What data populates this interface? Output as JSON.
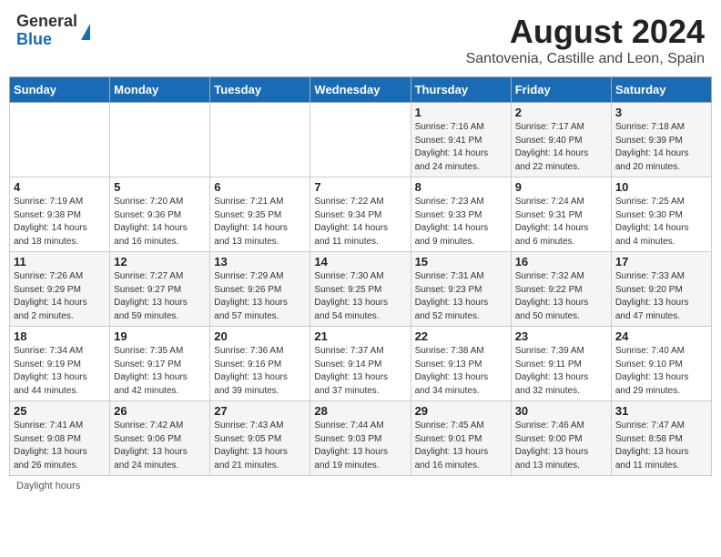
{
  "header": {
    "logo_general": "General",
    "logo_blue": "Blue",
    "main_title": "August 2024",
    "sub_title": "Santovenia, Castille and Leon, Spain"
  },
  "days_of_week": [
    "Sunday",
    "Monday",
    "Tuesday",
    "Wednesday",
    "Thursday",
    "Friday",
    "Saturday"
  ],
  "weeks": [
    [
      {
        "day": "",
        "info": ""
      },
      {
        "day": "",
        "info": ""
      },
      {
        "day": "",
        "info": ""
      },
      {
        "day": "",
        "info": ""
      },
      {
        "day": "1",
        "info": "Sunrise: 7:16 AM\nSunset: 9:41 PM\nDaylight: 14 hours\nand 24 minutes."
      },
      {
        "day": "2",
        "info": "Sunrise: 7:17 AM\nSunset: 9:40 PM\nDaylight: 14 hours\nand 22 minutes."
      },
      {
        "day": "3",
        "info": "Sunrise: 7:18 AM\nSunset: 9:39 PM\nDaylight: 14 hours\nand 20 minutes."
      }
    ],
    [
      {
        "day": "4",
        "info": "Sunrise: 7:19 AM\nSunset: 9:38 PM\nDaylight: 14 hours\nand 18 minutes."
      },
      {
        "day": "5",
        "info": "Sunrise: 7:20 AM\nSunset: 9:36 PM\nDaylight: 14 hours\nand 16 minutes."
      },
      {
        "day": "6",
        "info": "Sunrise: 7:21 AM\nSunset: 9:35 PM\nDaylight: 14 hours\nand 13 minutes."
      },
      {
        "day": "7",
        "info": "Sunrise: 7:22 AM\nSunset: 9:34 PM\nDaylight: 14 hours\nand 11 minutes."
      },
      {
        "day": "8",
        "info": "Sunrise: 7:23 AM\nSunset: 9:33 PM\nDaylight: 14 hours\nand 9 minutes."
      },
      {
        "day": "9",
        "info": "Sunrise: 7:24 AM\nSunset: 9:31 PM\nDaylight: 14 hours\nand 6 minutes."
      },
      {
        "day": "10",
        "info": "Sunrise: 7:25 AM\nSunset: 9:30 PM\nDaylight: 14 hours\nand 4 minutes."
      }
    ],
    [
      {
        "day": "11",
        "info": "Sunrise: 7:26 AM\nSunset: 9:29 PM\nDaylight: 14 hours\nand 2 minutes."
      },
      {
        "day": "12",
        "info": "Sunrise: 7:27 AM\nSunset: 9:27 PM\nDaylight: 13 hours\nand 59 minutes."
      },
      {
        "day": "13",
        "info": "Sunrise: 7:29 AM\nSunset: 9:26 PM\nDaylight: 13 hours\nand 57 minutes."
      },
      {
        "day": "14",
        "info": "Sunrise: 7:30 AM\nSunset: 9:25 PM\nDaylight: 13 hours\nand 54 minutes."
      },
      {
        "day": "15",
        "info": "Sunrise: 7:31 AM\nSunset: 9:23 PM\nDaylight: 13 hours\nand 52 minutes."
      },
      {
        "day": "16",
        "info": "Sunrise: 7:32 AM\nSunset: 9:22 PM\nDaylight: 13 hours\nand 50 minutes."
      },
      {
        "day": "17",
        "info": "Sunrise: 7:33 AM\nSunset: 9:20 PM\nDaylight: 13 hours\nand 47 minutes."
      }
    ],
    [
      {
        "day": "18",
        "info": "Sunrise: 7:34 AM\nSunset: 9:19 PM\nDaylight: 13 hours\nand 44 minutes."
      },
      {
        "day": "19",
        "info": "Sunrise: 7:35 AM\nSunset: 9:17 PM\nDaylight: 13 hours\nand 42 minutes."
      },
      {
        "day": "20",
        "info": "Sunrise: 7:36 AM\nSunset: 9:16 PM\nDaylight: 13 hours\nand 39 minutes."
      },
      {
        "day": "21",
        "info": "Sunrise: 7:37 AM\nSunset: 9:14 PM\nDaylight: 13 hours\nand 37 minutes."
      },
      {
        "day": "22",
        "info": "Sunrise: 7:38 AM\nSunset: 9:13 PM\nDaylight: 13 hours\nand 34 minutes."
      },
      {
        "day": "23",
        "info": "Sunrise: 7:39 AM\nSunset: 9:11 PM\nDaylight: 13 hours\nand 32 minutes."
      },
      {
        "day": "24",
        "info": "Sunrise: 7:40 AM\nSunset: 9:10 PM\nDaylight: 13 hours\nand 29 minutes."
      }
    ],
    [
      {
        "day": "25",
        "info": "Sunrise: 7:41 AM\nSunset: 9:08 PM\nDaylight: 13 hours\nand 26 minutes."
      },
      {
        "day": "26",
        "info": "Sunrise: 7:42 AM\nSunset: 9:06 PM\nDaylight: 13 hours\nand 24 minutes."
      },
      {
        "day": "27",
        "info": "Sunrise: 7:43 AM\nSunset: 9:05 PM\nDaylight: 13 hours\nand 21 minutes."
      },
      {
        "day": "28",
        "info": "Sunrise: 7:44 AM\nSunset: 9:03 PM\nDaylight: 13 hours\nand 19 minutes."
      },
      {
        "day": "29",
        "info": "Sunrise: 7:45 AM\nSunset: 9:01 PM\nDaylight: 13 hours\nand 16 minutes."
      },
      {
        "day": "30",
        "info": "Sunrise: 7:46 AM\nSunset: 9:00 PM\nDaylight: 13 hours\nand 13 minutes."
      },
      {
        "day": "31",
        "info": "Sunrise: 7:47 AM\nSunset: 8:58 PM\nDaylight: 13 hours\nand 11 minutes."
      }
    ]
  ],
  "footer": "Daylight hours"
}
